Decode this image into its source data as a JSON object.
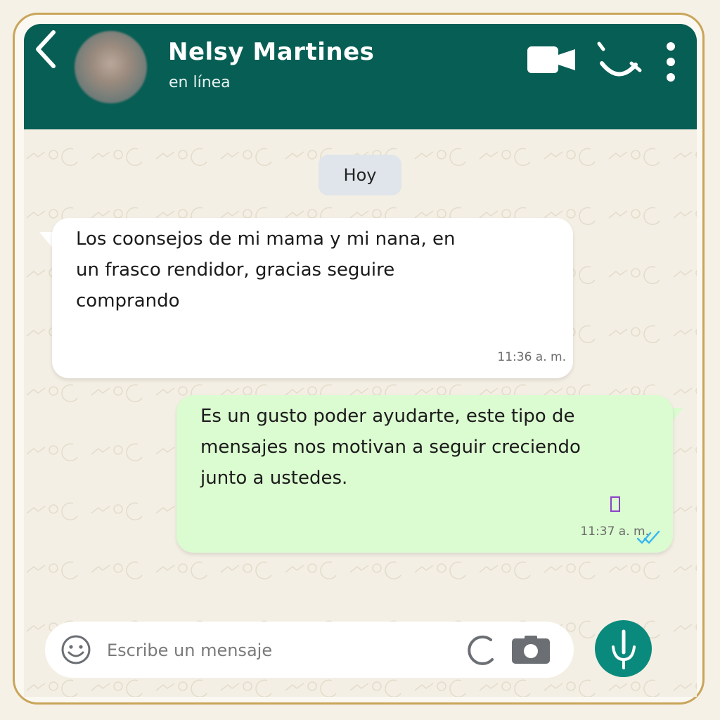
{
  "header": {
    "contact_name": "Nelsy Martines",
    "status": "en línea",
    "colors": {
      "bar": "#075e54",
      "text": "#ffffff"
    },
    "icons": [
      "back-arrow-icon",
      "avatar",
      "video-call-icon",
      "voice-call-icon",
      "more-options-icon"
    ]
  },
  "chat": {
    "date_label": "Hoy",
    "messages": [
      {
        "direction": "incoming",
        "text": "Los coonsejos de mi mama y mi nana, en\nun frasco rendidor, gracias seguire\ncomprando",
        "time": "11:36 a. m."
      },
      {
        "direction": "outgoing",
        "text": "Es un gusto poder ayudarte, este tipo de\nmensajes nos motivan a seguir creciendo\njunto a ustedes.",
        "time": "11:37 a. m.",
        "status": "read-double-check"
      }
    ],
    "colors": {
      "incoming": "#ffffff",
      "outgoing": "#dbfbd0",
      "read_ticks": "#34b7f1"
    }
  },
  "composer": {
    "placeholder": "Escribe un mensaje",
    "value": "",
    "icons": [
      "emoji-icon",
      "attach-icon",
      "camera-icon",
      "microphone-icon"
    ],
    "mic_color": "#0a8a7c"
  }
}
